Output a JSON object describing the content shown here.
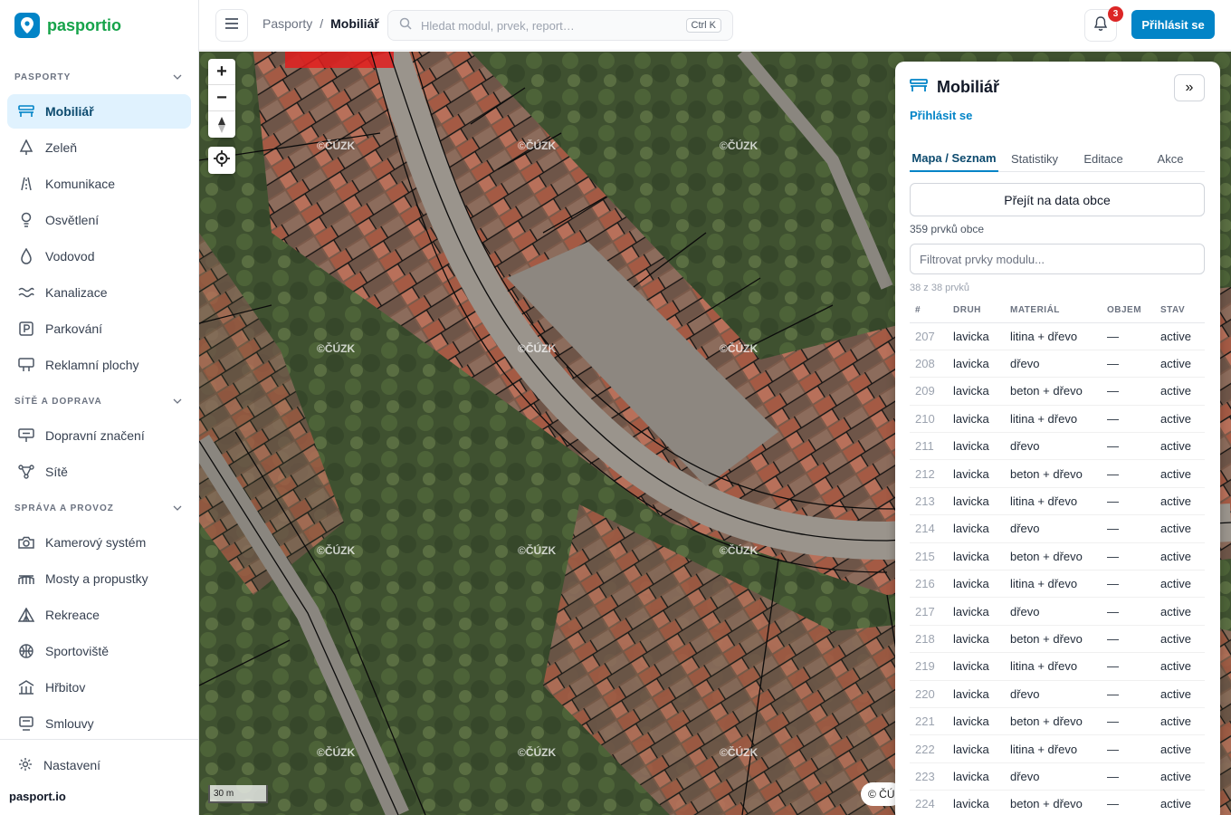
{
  "app": {
    "logo": "pasportio",
    "footer_brand": "pasport.io"
  },
  "sidebar": {
    "sections": [
      {
        "title": "PASPORTY",
        "items": [
          {
            "label": "Mobiliář",
            "icon": "bench-icon",
            "active": true
          },
          {
            "label": "Zeleň",
            "icon": "tree-icon"
          },
          {
            "label": "Komunikace",
            "icon": "road-icon"
          },
          {
            "label": "Osvětlení",
            "icon": "lamp-icon"
          },
          {
            "label": "Vodovod",
            "icon": "droplet-icon"
          },
          {
            "label": "Kanalizace",
            "icon": "waves-icon"
          },
          {
            "label": "Parkování",
            "icon": "parking-icon"
          },
          {
            "label": "Reklamní plochy",
            "icon": "billboard-icon"
          }
        ]
      },
      {
        "title": "SÍTĚ A DOPRAVA",
        "items": [
          {
            "label": "Dopravní značení",
            "icon": "sign-icon"
          },
          {
            "label": "Sítě",
            "icon": "network-icon"
          }
        ]
      },
      {
        "title": "SPRÁVA A PROVOZ",
        "items": [
          {
            "label": "Kamerový systém",
            "icon": "camera-icon"
          },
          {
            "label": "Mosty a propustky",
            "icon": "bridge-icon"
          },
          {
            "label": "Rekreace",
            "icon": "tent-icon"
          },
          {
            "label": "Sportoviště",
            "icon": "ball-icon"
          },
          {
            "label": "Hřbitov",
            "icon": "building-icon"
          },
          {
            "label": "Smlouvy",
            "icon": "document-icon"
          }
        ]
      }
    ],
    "settings_label": "Nastavení"
  },
  "topbar": {
    "breadcrumb": [
      "Pasporty",
      "Mobiliář"
    ],
    "search_placeholder": "Hledat modul, prvek, report…",
    "search_shortcut": "Ctrl K",
    "notifications_count": "3",
    "login_label": "Přihlásit se"
  },
  "map": {
    "scale_label": "30 m",
    "attribution": "© ČÚ",
    "watermark": "©ČÚZK"
  },
  "panel": {
    "title": "Mobiliář",
    "login_link": "Přihlásit se",
    "tabs": [
      "Mapa / Seznam",
      "Statistiky",
      "Editace",
      "Akce"
    ],
    "active_tab": 0,
    "data_button": "Přejít na data obce",
    "count_text": "359 prvků obce",
    "filter_placeholder": "Filtrovat prvky modulu...",
    "shown_text": "38 z 38 prvků",
    "columns": [
      "#",
      "DRUH",
      "MATERIÁL",
      "OBJEM",
      "STAV"
    ],
    "rows": [
      [
        "207",
        "lavicka",
        "litina + dřevo",
        "—",
        "active"
      ],
      [
        "208",
        "lavicka",
        "dřevo",
        "—",
        "active"
      ],
      [
        "209",
        "lavicka",
        "beton + dřevo",
        "—",
        "active"
      ],
      [
        "210",
        "lavicka",
        "litina + dřevo",
        "—",
        "active"
      ],
      [
        "211",
        "lavicka",
        "dřevo",
        "—",
        "active"
      ],
      [
        "212",
        "lavicka",
        "beton + dřevo",
        "—",
        "active"
      ],
      [
        "213",
        "lavicka",
        "litina + dřevo",
        "—",
        "active"
      ],
      [
        "214",
        "lavicka",
        "dřevo",
        "—",
        "active"
      ],
      [
        "215",
        "lavicka",
        "beton + dřevo",
        "—",
        "active"
      ],
      [
        "216",
        "lavicka",
        "litina + dřevo",
        "—",
        "active"
      ],
      [
        "217",
        "lavicka",
        "dřevo",
        "—",
        "active"
      ],
      [
        "218",
        "lavicka",
        "beton + dřevo",
        "—",
        "active"
      ],
      [
        "219",
        "lavicka",
        "litina + dřevo",
        "—",
        "active"
      ],
      [
        "220",
        "lavicka",
        "dřevo",
        "—",
        "active"
      ],
      [
        "221",
        "lavicka",
        "beton + dřevo",
        "—",
        "active"
      ],
      [
        "222",
        "lavicka",
        "litina + dřevo",
        "—",
        "active"
      ],
      [
        "223",
        "lavicka",
        "dřevo",
        "—",
        "active"
      ],
      [
        "224",
        "lavicka",
        "beton + dřevo",
        "—",
        "active"
      ]
    ]
  },
  "colors": {
    "accent": "#0284c7",
    "brand_green": "#16a34a",
    "active_bg": "#e0f2fe",
    "badge": "#dc2626"
  }
}
